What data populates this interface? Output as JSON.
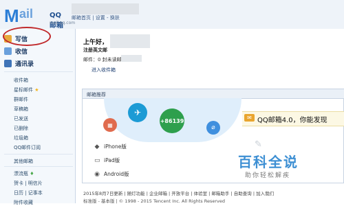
{
  "header": {
    "logo_mark": "M",
    "logo_text": "ail",
    "logo_qq": "QQ邮箱",
    "logo_url": "mail.qq.com",
    "links": "邮箱首页 | 设置 - 换肤"
  },
  "sidebar": {
    "primary": [
      {
        "label": "写信",
        "icon": "pencil-icon"
      },
      {
        "label": "收信",
        "icon": "inbox-icon"
      },
      {
        "label": "通讯录",
        "icon": "contacts-icon"
      }
    ],
    "folders": [
      "收件箱",
      "星标邮件",
      "群邮件",
      "草稿箱",
      "已发送",
      "已删除",
      "垃圾箱",
      "QQ邮件订阅"
    ],
    "other": [
      "其他邮箱"
    ],
    "apps": [
      "漂流瓶",
      "贺卡 | 明信片",
      "日历 | 记事本",
      "附件收藏"
    ]
  },
  "main": {
    "greeting": "上午好，",
    "register_line": "注册英文邮",
    "mail_line": "邮件：0 封未读邮件",
    "inbox_link": "进入收件箱"
  },
  "recommend": {
    "title": "邮箱推荐",
    "call_badge": "+86",
    "call_badge_num": "139",
    "banner_text": "QQ邮箱4.0，你能发现",
    "options": [
      "iPhone版",
      "iPad版",
      "Android版"
    ]
  },
  "watermark": {
    "main": "百科全说",
    "sub": "助你轻松解疾"
  },
  "footer": {
    "line1": "2015年8月7日更新 | 随灯功能 | 企业邮箱 | 开放平台 | 体验室 | 邮箱助手 | 自助查询 | 加入我们",
    "line2": "标准版 - 基本版 | © 1998 - 2015 Tencent Inc. All Rights Reserved"
  },
  "colors": {
    "brand_blue": "#2c7ed6",
    "circle_highlight": "#c0292b",
    "star": "#f3b51b"
  }
}
